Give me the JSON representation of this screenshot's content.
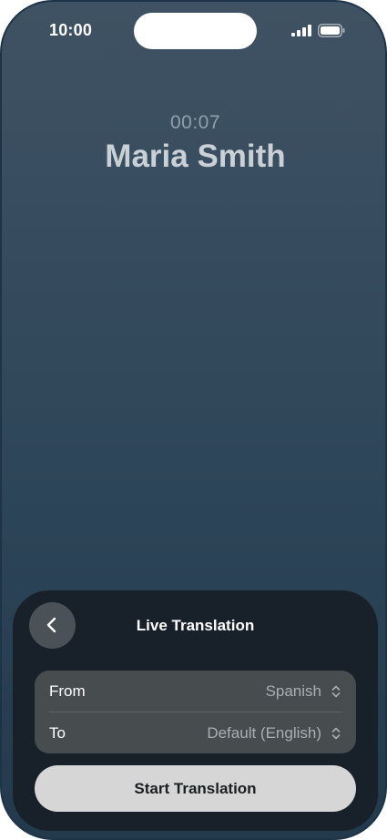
{
  "status_bar": {
    "time": "10:00",
    "signal_icon": "cellular-signal-icon",
    "battery_icon": "battery-icon"
  },
  "call": {
    "timer": "00:07",
    "caller_name": "Maria Smith"
  },
  "translation_panel": {
    "back_icon": "chevron-left-icon",
    "title": "Live Translation",
    "from_label": "From",
    "from_value": "Spanish",
    "to_label": "To",
    "to_value": "Default (English)",
    "selector_icon": "chevron-up-down-icon",
    "start_label": "Start Translation"
  },
  "colors": {
    "background_top": "#3f5263",
    "background_bottom": "#233a4d",
    "sheet": "#18212a",
    "card": "#474c4f",
    "button": "#d6d6d6"
  }
}
